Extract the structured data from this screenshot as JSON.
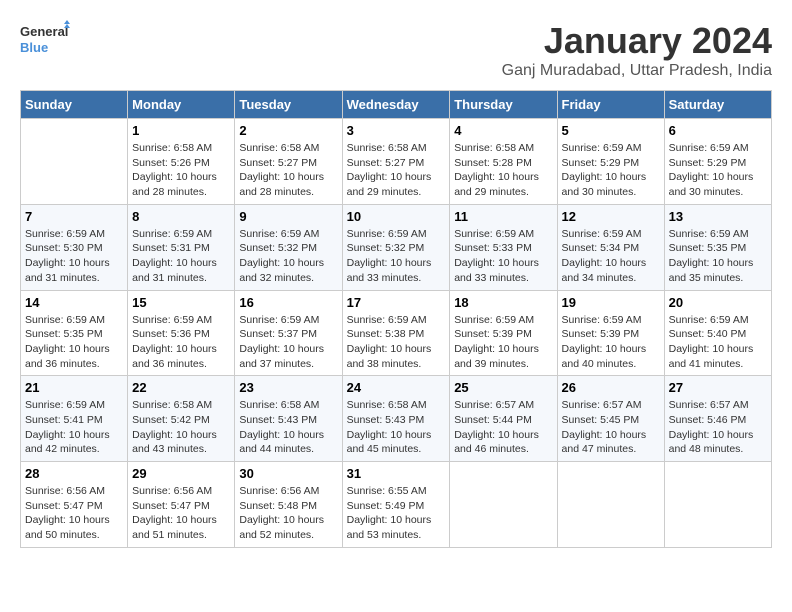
{
  "header": {
    "logo_line1": "General",
    "logo_line2": "Blue",
    "title": "January 2024",
    "subtitle": "Ganj Muradabad, Uttar Pradesh, India"
  },
  "weekdays": [
    "Sunday",
    "Monday",
    "Tuesday",
    "Wednesday",
    "Thursday",
    "Friday",
    "Saturday"
  ],
  "weeks": [
    [
      {
        "day": "",
        "sunrise": "",
        "sunset": "",
        "daylight": ""
      },
      {
        "day": "1",
        "sunrise": "6:58 AM",
        "sunset": "5:26 PM",
        "daylight": "10 hours and 28 minutes."
      },
      {
        "day": "2",
        "sunrise": "6:58 AM",
        "sunset": "5:27 PM",
        "daylight": "10 hours and 28 minutes."
      },
      {
        "day": "3",
        "sunrise": "6:58 AM",
        "sunset": "5:27 PM",
        "daylight": "10 hours and 29 minutes."
      },
      {
        "day": "4",
        "sunrise": "6:58 AM",
        "sunset": "5:28 PM",
        "daylight": "10 hours and 29 minutes."
      },
      {
        "day": "5",
        "sunrise": "6:59 AM",
        "sunset": "5:29 PM",
        "daylight": "10 hours and 30 minutes."
      },
      {
        "day": "6",
        "sunrise": "6:59 AM",
        "sunset": "5:29 PM",
        "daylight": "10 hours and 30 minutes."
      }
    ],
    [
      {
        "day": "7",
        "sunrise": "6:59 AM",
        "sunset": "5:30 PM",
        "daylight": "10 hours and 31 minutes."
      },
      {
        "day": "8",
        "sunrise": "6:59 AM",
        "sunset": "5:31 PM",
        "daylight": "10 hours and 31 minutes."
      },
      {
        "day": "9",
        "sunrise": "6:59 AM",
        "sunset": "5:32 PM",
        "daylight": "10 hours and 32 minutes."
      },
      {
        "day": "10",
        "sunrise": "6:59 AM",
        "sunset": "5:32 PM",
        "daylight": "10 hours and 33 minutes."
      },
      {
        "day": "11",
        "sunrise": "6:59 AM",
        "sunset": "5:33 PM",
        "daylight": "10 hours and 33 minutes."
      },
      {
        "day": "12",
        "sunrise": "6:59 AM",
        "sunset": "5:34 PM",
        "daylight": "10 hours and 34 minutes."
      },
      {
        "day": "13",
        "sunrise": "6:59 AM",
        "sunset": "5:35 PM",
        "daylight": "10 hours and 35 minutes."
      }
    ],
    [
      {
        "day": "14",
        "sunrise": "6:59 AM",
        "sunset": "5:35 PM",
        "daylight": "10 hours and 36 minutes."
      },
      {
        "day": "15",
        "sunrise": "6:59 AM",
        "sunset": "5:36 PM",
        "daylight": "10 hours and 36 minutes."
      },
      {
        "day": "16",
        "sunrise": "6:59 AM",
        "sunset": "5:37 PM",
        "daylight": "10 hours and 37 minutes."
      },
      {
        "day": "17",
        "sunrise": "6:59 AM",
        "sunset": "5:38 PM",
        "daylight": "10 hours and 38 minutes."
      },
      {
        "day": "18",
        "sunrise": "6:59 AM",
        "sunset": "5:39 PM",
        "daylight": "10 hours and 39 minutes."
      },
      {
        "day": "19",
        "sunrise": "6:59 AM",
        "sunset": "5:39 PM",
        "daylight": "10 hours and 40 minutes."
      },
      {
        "day": "20",
        "sunrise": "6:59 AM",
        "sunset": "5:40 PM",
        "daylight": "10 hours and 41 minutes."
      }
    ],
    [
      {
        "day": "21",
        "sunrise": "6:59 AM",
        "sunset": "5:41 PM",
        "daylight": "10 hours and 42 minutes."
      },
      {
        "day": "22",
        "sunrise": "6:58 AM",
        "sunset": "5:42 PM",
        "daylight": "10 hours and 43 minutes."
      },
      {
        "day": "23",
        "sunrise": "6:58 AM",
        "sunset": "5:43 PM",
        "daylight": "10 hours and 44 minutes."
      },
      {
        "day": "24",
        "sunrise": "6:58 AM",
        "sunset": "5:43 PM",
        "daylight": "10 hours and 45 minutes."
      },
      {
        "day": "25",
        "sunrise": "6:57 AM",
        "sunset": "5:44 PM",
        "daylight": "10 hours and 46 minutes."
      },
      {
        "day": "26",
        "sunrise": "6:57 AM",
        "sunset": "5:45 PM",
        "daylight": "10 hours and 47 minutes."
      },
      {
        "day": "27",
        "sunrise": "6:57 AM",
        "sunset": "5:46 PM",
        "daylight": "10 hours and 48 minutes."
      }
    ],
    [
      {
        "day": "28",
        "sunrise": "6:56 AM",
        "sunset": "5:47 PM",
        "daylight": "10 hours and 50 minutes."
      },
      {
        "day": "29",
        "sunrise": "6:56 AM",
        "sunset": "5:47 PM",
        "daylight": "10 hours and 51 minutes."
      },
      {
        "day": "30",
        "sunrise": "6:56 AM",
        "sunset": "5:48 PM",
        "daylight": "10 hours and 52 minutes."
      },
      {
        "day": "31",
        "sunrise": "6:55 AM",
        "sunset": "5:49 PM",
        "daylight": "10 hours and 53 minutes."
      },
      {
        "day": "",
        "sunrise": "",
        "sunset": "",
        "daylight": ""
      },
      {
        "day": "",
        "sunrise": "",
        "sunset": "",
        "daylight": ""
      },
      {
        "day": "",
        "sunrise": "",
        "sunset": "",
        "daylight": ""
      }
    ]
  ]
}
